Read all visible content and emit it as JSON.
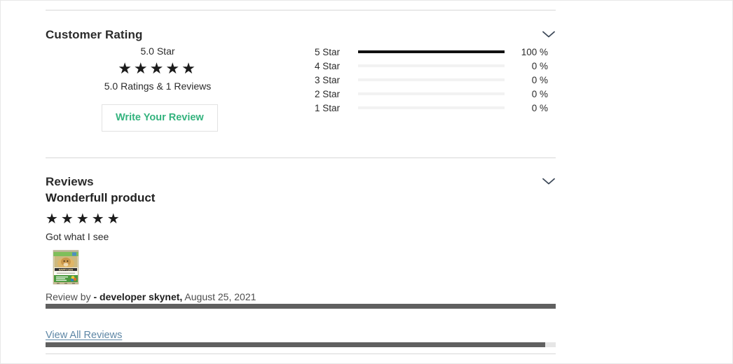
{
  "customer_rating": {
    "heading": "Customer Rating",
    "collapse_icon": "chevron-down-icon",
    "summary": {
      "score_text": "5.0 Star",
      "stars_glyphs": "★★★★★",
      "stars_filled": 5,
      "counts_text": "5.0 Ratings & 1 Reviews",
      "write_review_label": "Write Your Review",
      "write_review_color": "#34b37e"
    },
    "breakdown": [
      {
        "label": "5 Star",
        "percent_text": "100 %",
        "percent": 100
      },
      {
        "label": "4 Star",
        "percent_text": "0 %",
        "percent": 0
      },
      {
        "label": "3 Star",
        "percent_text": "0 %",
        "percent": 0
      },
      {
        "label": "2 Star",
        "percent_text": "0 %",
        "percent": 0
      },
      {
        "label": "1 Star",
        "percent_text": "0 %",
        "percent": 0
      }
    ]
  },
  "reviews": {
    "heading": "Reviews",
    "collapse_icon": "chevron-down-icon",
    "item": {
      "title": "Wonderfull product",
      "stars_glyphs": "★★★★★",
      "stars_filled": 5,
      "body": "Got what I see",
      "thumbnail_alt": "happy-dog-food-bag",
      "byline_prefix": "Review by ",
      "author": "- developer skynet,",
      "date": " August 25, 2021"
    },
    "view_all_label": "View All Reviews",
    "view_all_color": "#5e87a6"
  },
  "scrollbars": {
    "review_scroll_thumb_percent": 100,
    "page_scroll_thumb_percent": 98
  },
  "colors": {
    "text": "#2b2b2b",
    "bar_filled": "#111111",
    "bar_track": "#f2f2f2",
    "divider": "#d8d8d8",
    "scroll_thumb": "#606060"
  }
}
